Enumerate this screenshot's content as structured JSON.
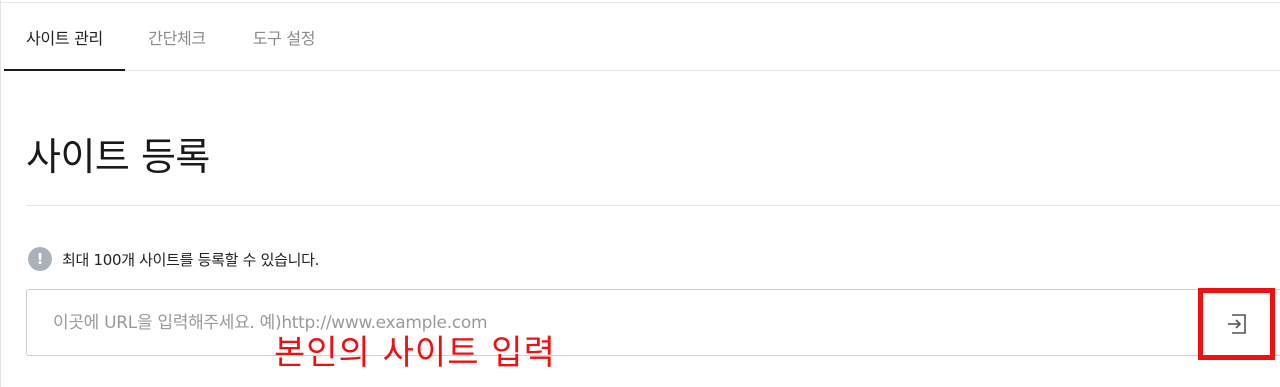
{
  "tabs": [
    {
      "label": "사이트 관리",
      "active": true
    },
    {
      "label": "간단체크",
      "active": false
    },
    {
      "label": "도구 설정",
      "active": false
    }
  ],
  "page": {
    "title": "사이트 등록"
  },
  "notice": {
    "icon": "exclamation-icon",
    "text": "최대 100개 사이트를 등록할 수 있습니다."
  },
  "url_field": {
    "value": "",
    "placeholder": "이곳에 URL을 입력해주세요. 예)http://www.example.com"
  },
  "submit": {
    "icon": "enter-icon"
  },
  "annotation": {
    "text": "본인의 사이트 입력",
    "color": "#ee1111"
  },
  "colors": {
    "accent_red": "#ee1111",
    "active_tab_bar": "#1a1a1a",
    "notice_icon_bg": "#a9b1ba"
  }
}
